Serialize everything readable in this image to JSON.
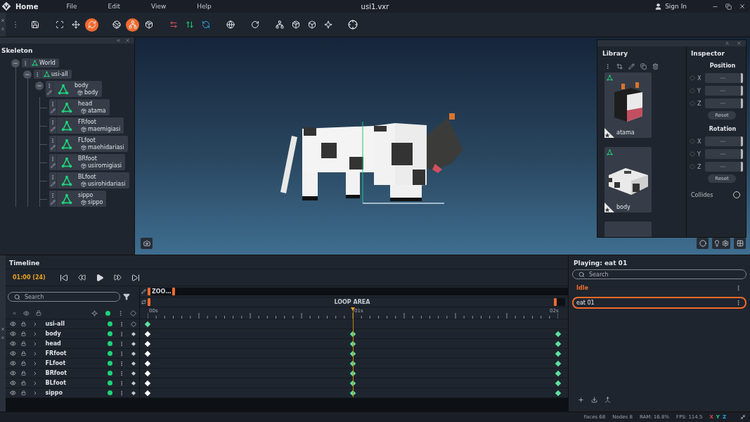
{
  "titlebar": {
    "app": "Home",
    "menus": [
      "File",
      "Edit",
      "View",
      "Help"
    ],
    "file": "usi1.vxr",
    "account": "Sign In"
  },
  "toolbar": [
    {
      "kind": "save",
      "selected": false
    },
    {
      "kind": "fit",
      "selected": false
    },
    {
      "kind": "move",
      "selected": false
    },
    {
      "kind": "rotate",
      "selected": true
    },
    {
      "kind": "world",
      "selected": false
    },
    {
      "kind": "bones",
      "selected": true
    },
    {
      "kind": "object",
      "selected": false
    },
    {
      "kind": "swap-x",
      "selected": false
    },
    {
      "kind": "swap-y",
      "selected": false
    },
    {
      "kind": "swap-z",
      "selected": false
    },
    {
      "kind": "globe",
      "selected": false
    },
    {
      "kind": "reset",
      "selected": false
    },
    {
      "kind": "hierarchy",
      "selected": false
    },
    {
      "kind": "solid",
      "selected": false
    },
    {
      "kind": "wire",
      "selected": false
    },
    {
      "kind": "spark",
      "selected": false
    },
    {
      "kind": "target",
      "selected": false
    }
  ],
  "skeleton": {
    "title": "Skeleton",
    "tree": [
      {
        "kind": "group",
        "name": "World",
        "expanded": true,
        "children": [
          {
            "kind": "group",
            "name": "usi-all",
            "expanded": true,
            "children": [
              {
                "kind": "bone",
                "name": "body",
                "mesh": "body",
                "expanded": true,
                "children": [
                  {
                    "kind": "bone",
                    "name": "head",
                    "mesh": "atama"
                  },
                  {
                    "kind": "bone",
                    "name": "FRfoot",
                    "mesh": "maemigiasi"
                  },
                  {
                    "kind": "bone",
                    "name": "FLfoot",
                    "mesh": "maehidariasi"
                  },
                  {
                    "kind": "bone",
                    "name": "BRfoot",
                    "mesh": "usiromigiasi"
                  },
                  {
                    "kind": "bone",
                    "name": "BLfoot",
                    "mesh": "usirohidariasi"
                  },
                  {
                    "kind": "bone",
                    "name": "sippo",
                    "mesh": "sippo"
                  }
                ]
              }
            ]
          }
        ]
      }
    ]
  },
  "library": {
    "title": "Library",
    "items": [
      {
        "kind": "head",
        "name": "atama"
      },
      {
        "kind": "body",
        "name": "body"
      }
    ]
  },
  "inspector": {
    "title": "Inspector",
    "disabled": true,
    "sections": [
      {
        "title": "Position",
        "fields": [
          {
            "axis": "X",
            "value": "---"
          },
          {
            "axis": "Y",
            "value": "---"
          },
          {
            "axis": "Z",
            "value": "---"
          }
        ],
        "button": "Reset"
      },
      {
        "title": "Rotation",
        "fields": [
          {
            "axis": "X",
            "value": "---"
          },
          {
            "axis": "Y",
            "value": "---"
          },
          {
            "axis": "Z",
            "value": "---"
          }
        ],
        "button": "Reset"
      }
    ],
    "collides": {
      "label": "Collides",
      "checked": false
    }
  },
  "timeline": {
    "title": "Timeline",
    "time": "01:00 (24)",
    "search_placeholder": "Search",
    "zoom_label": "ZOO…",
    "loop_label": "LOOP AREA",
    "ticks": [
      {
        "label": "00s",
        "current": false
      },
      {
        "label": "01s",
        "current": true
      },
      {
        "label": "02s",
        "current": false
      }
    ],
    "tracks": [
      {
        "kind": "root",
        "name": "usi-all"
      },
      {
        "kind": "bone",
        "name": "body"
      },
      {
        "kind": "bone",
        "name": "head"
      },
      {
        "kind": "bone",
        "name": "FRfoot"
      },
      {
        "kind": "bone",
        "name": "FLfoot"
      },
      {
        "kind": "bone",
        "name": "BRfoot"
      },
      {
        "kind": "bone",
        "name": "BLfoot"
      },
      {
        "kind": "bone",
        "name": "sippo"
      }
    ]
  },
  "animations": {
    "title": "Playing: eat 01",
    "search_placeholder": "Search",
    "items": [
      {
        "name": "Idle",
        "default": true,
        "selected": false
      },
      {
        "name": "eat 01",
        "default": false,
        "selected": true
      }
    ]
  },
  "status": {
    "stats": [
      "Faces 68",
      "Nodes 8",
      "RAM: 16.8%",
      "FPS: 114.5"
    ],
    "axes": [
      {
        "label": "X",
        "color": "#e0404f"
      },
      {
        "label": "Y",
        "color": "#1ed37a"
      },
      {
        "label": "Z",
        "color": "#2aa7e8"
      }
    ]
  }
}
